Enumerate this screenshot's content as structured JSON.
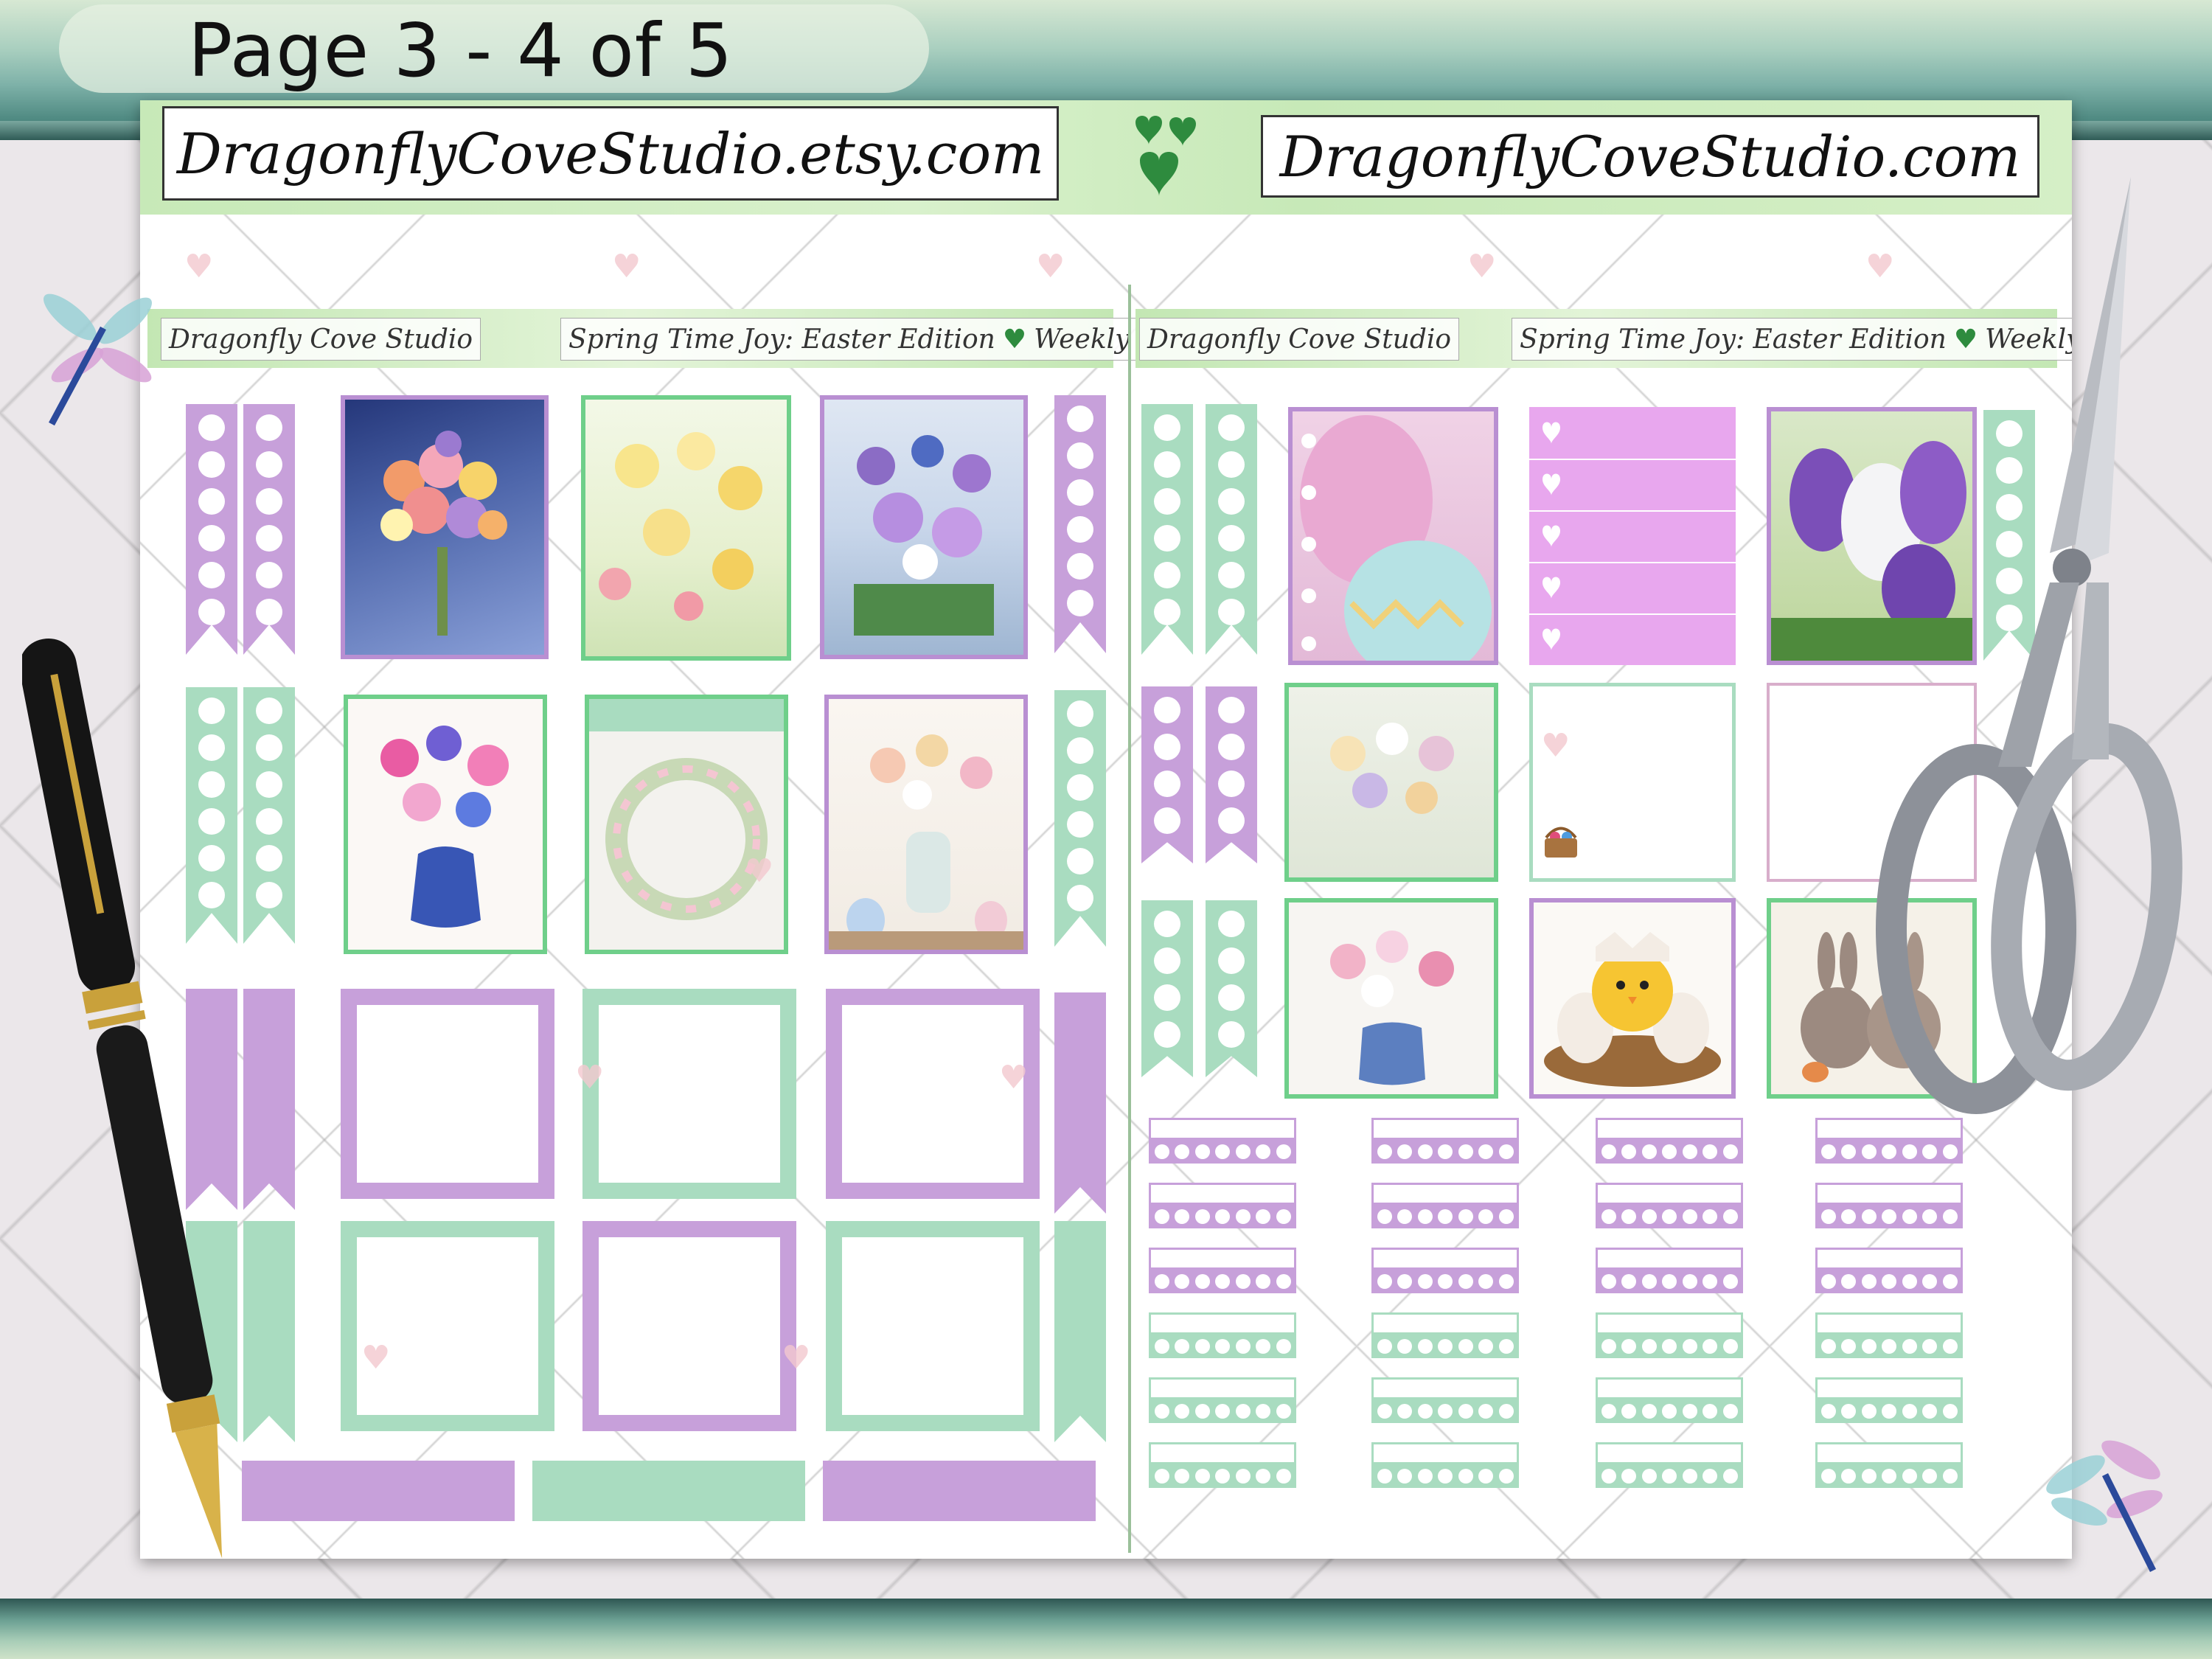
{
  "page": {
    "label": "Page 3 - 4 of 5"
  },
  "domains": {
    "etsy": "DragonflyCoveStudio.etsy.com",
    "site": "DragonflyCoveStudio.com"
  },
  "headers": {
    "brand": "Dragonfly Cove Studio",
    "theme": "Spring Time Joy: Easter Edition",
    "weekly": "Weekly"
  },
  "icons": {
    "hearts": "heart-cluster-icon",
    "dragonfly": "dragonfly-icon",
    "pen": "fountain-pen",
    "scissors": "scissors"
  },
  "colors": {
    "purple": "#c7a0da",
    "mint": "#a9dcc0",
    "pink_check": "#e8a7ee"
  }
}
